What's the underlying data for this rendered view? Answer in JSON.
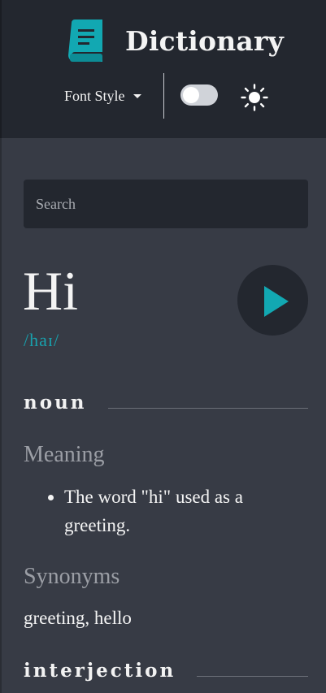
{
  "header": {
    "title": "Dictionary",
    "font_style_label": "Font Style",
    "book_icon_color": "#12a8b2"
  },
  "search": {
    "placeholder": "Search",
    "value": ""
  },
  "entry": {
    "word": "Hi",
    "phonetic": "/haɪ/",
    "accent_color": "#18a1ad",
    "parts_of_speech": [
      {
        "label": "noun",
        "meaning_heading": "Meaning",
        "meanings": [
          "The word \"hi\" used as a greeting."
        ],
        "synonyms_heading": "Synonyms",
        "synonyms": "greeting, hello"
      },
      {
        "label": "interjection"
      }
    ]
  }
}
